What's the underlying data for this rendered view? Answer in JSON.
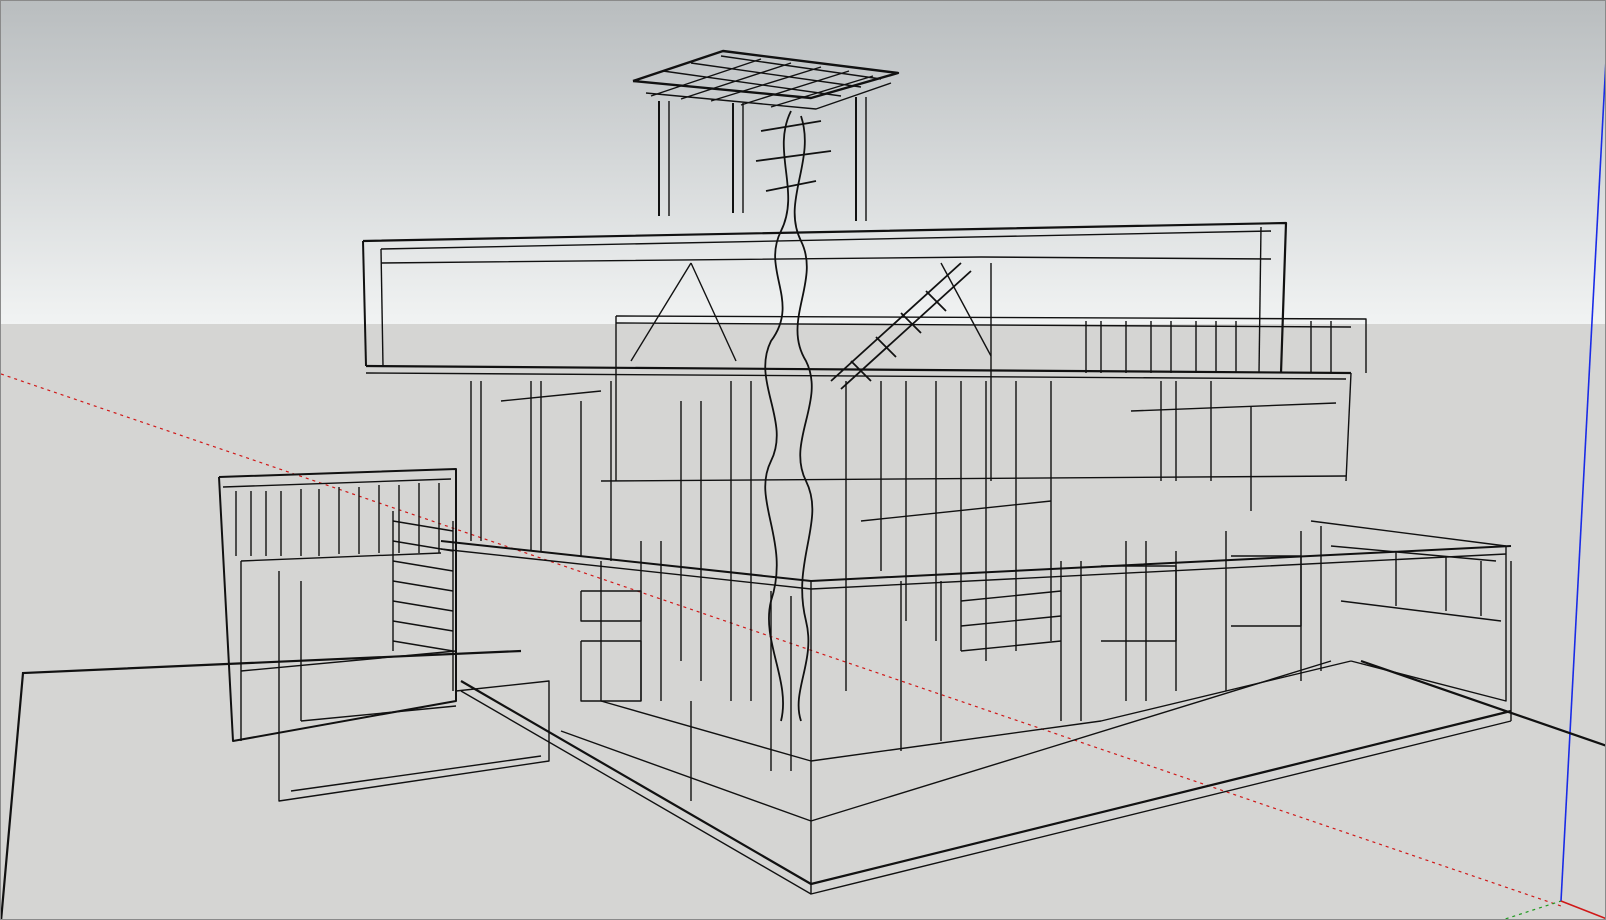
{
  "app": {
    "window_title": "",
    "view_style": "wireframe",
    "camera": "perspective"
  },
  "colors": {
    "sky_top": "#b9bdbf",
    "sky_bottom": "#f1f3f3",
    "ground": "#d5d5d3",
    "edge": "#111111",
    "axis_red": "#d01818",
    "axis_green": "#1f9a1f",
    "axis_blue": "#1a2be6"
  },
  "scene": {
    "model": "house-wireframe",
    "axes": [
      "red-axis",
      "green-axis",
      "blue-axis"
    ]
  }
}
